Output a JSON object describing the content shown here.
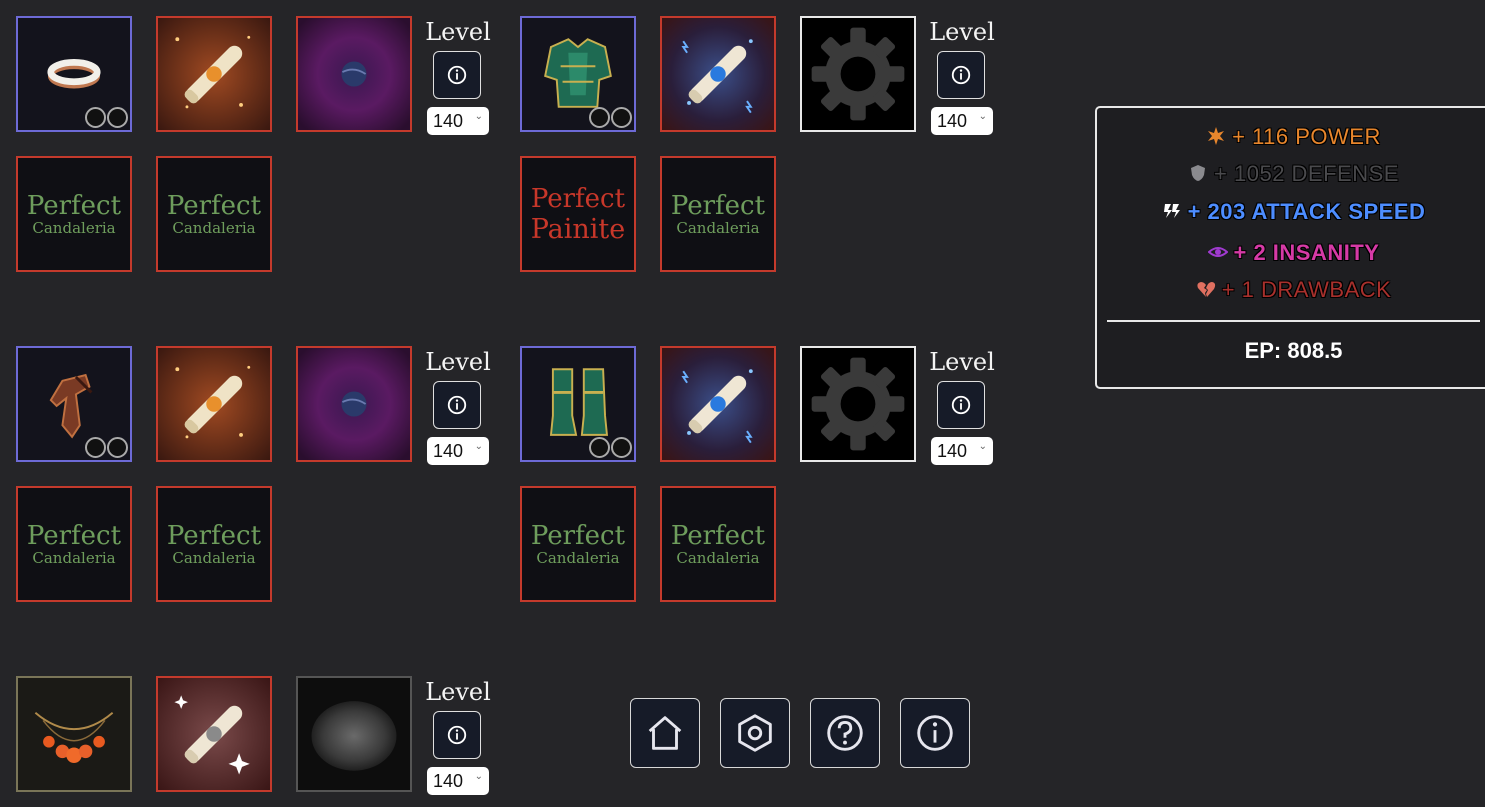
{
  "gear_groups": [
    {
      "name": "ring",
      "level_label": "Level",
      "level_value": "140",
      "gems": [
        {
          "line1": "Perfect",
          "line2": "Candaleria",
          "color": "#6e9d5c"
        },
        {
          "line1": "Perfect",
          "line2": "Candaleria",
          "color": "#6e9d5c"
        }
      ]
    },
    {
      "name": "chest",
      "level_label": "Level",
      "level_value": "140",
      "gems": [
        {
          "line1": "Perfect",
          "line2": "Painite",
          "color": "#c8372a"
        },
        {
          "line1": "Perfect",
          "line2": "Candaleria",
          "color": "#6e9d5c"
        }
      ]
    },
    {
      "name": "gloves",
      "level_label": "Level",
      "level_value": "140",
      "gems": [
        {
          "line1": "Perfect",
          "line2": "Candaleria",
          "color": "#6e9d5c"
        },
        {
          "line1": "Perfect",
          "line2": "Candaleria",
          "color": "#6e9d5c"
        }
      ]
    },
    {
      "name": "boots",
      "level_label": "Level",
      "level_value": "140",
      "gems": [
        {
          "line1": "Perfect",
          "line2": "Candaleria",
          "color": "#6e9d5c"
        },
        {
          "line1": "Perfect",
          "line2": "Candaleria",
          "color": "#6e9d5c"
        }
      ]
    },
    {
      "name": "amulet",
      "level_label": "Level",
      "level_value": "140",
      "gems": []
    }
  ],
  "stats": {
    "power": {
      "text": "+ 116 POWER",
      "color": "#e8862c",
      "icon": "starburst-icon"
    },
    "defense": {
      "text": "+ 1052 DEFENSE",
      "color": "#4a4a4d",
      "icon": "shield-icon"
    },
    "attack_speed": {
      "text": "+ 203 ATTACK SPEED",
      "color": "#4d8dff",
      "icon": "lightning-icon"
    },
    "insanity": {
      "text": "+ 2 INSANITY",
      "color": "#d63aa6",
      "icon": "eye-icon"
    },
    "drawback": {
      "text": "+ 1 DRAWBACK",
      "color": "#a8302c",
      "icon": "broken-heart-icon"
    },
    "ep": "EP: 808.5"
  },
  "nav_icons": [
    "home-icon",
    "hexagon-settings-icon",
    "help-icon",
    "info-icon"
  ],
  "accent_colors": {
    "rarity_purple": "#6d6ad6",
    "enchant_red": "#c43a2c",
    "gem_green": "#6e9d5c"
  }
}
